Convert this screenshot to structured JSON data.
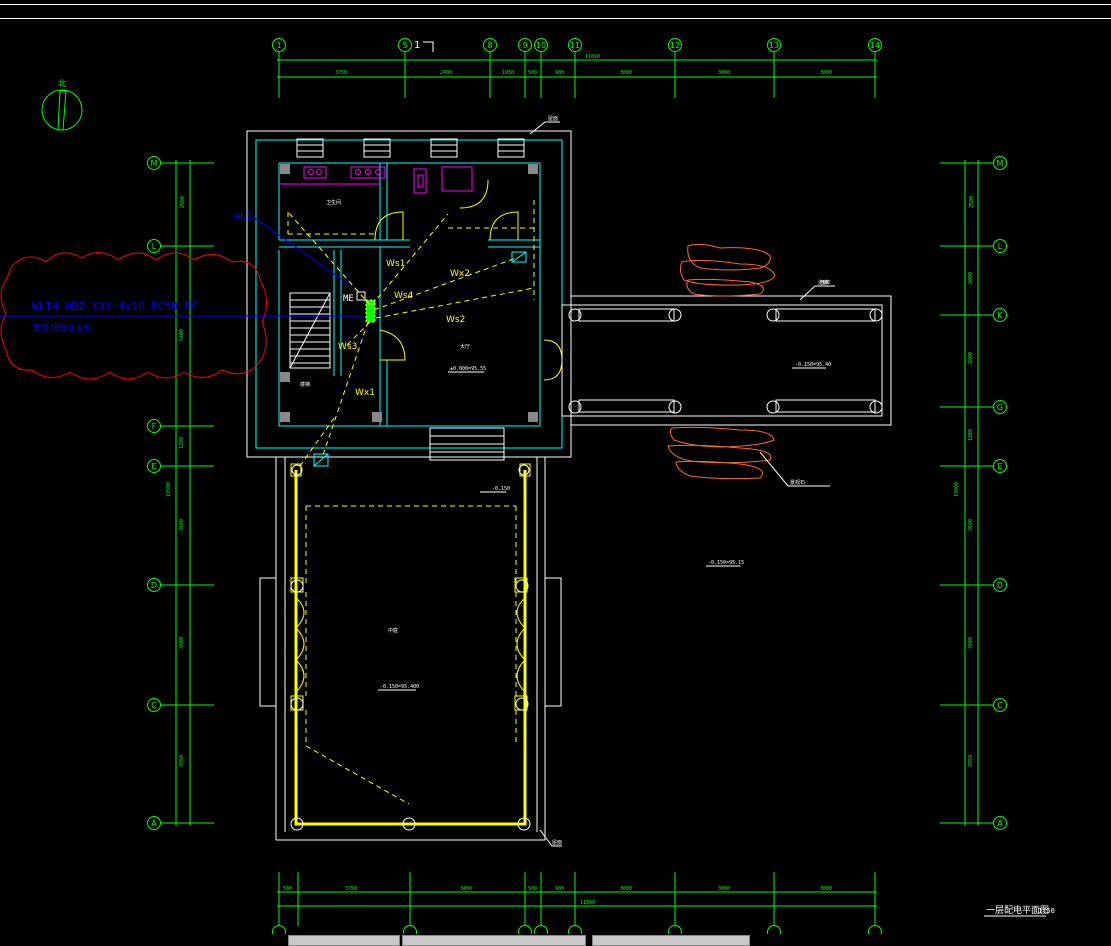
{
  "drawing": {
    "sheet_title": "一层配电平面图",
    "scale": "1:50",
    "north_label": "北",
    "section_mark": "1",
    "cable_label_line1": "WLI4  WDZ-YJY-4x16  PC50  FC",
    "cable_label_line2": "室外埋地0.8米",
    "tag_al": "AL1",
    "tag_mep": "ME",
    "circuit_labels": [
      "Ws1",
      "Wx2",
      "Ws4",
      "Ws2",
      "Ws3",
      "Wx1"
    ],
    "axis_top": [
      "1",
      "5",
      "8",
      "9",
      "10",
      "11",
      "12",
      "13",
      "14"
    ],
    "axis_left": [
      "M",
      "L",
      "F",
      "E",
      "D",
      "C",
      "A"
    ],
    "axis_right": [
      "M",
      "L",
      "K",
      "G",
      "E",
      "D",
      "C",
      "A"
    ],
    "room_labels": {
      "toilet": "卫生间",
      "stair": "楼梯",
      "hall": "大厅",
      "main_hall": "中庭",
      "corridor": "连廊"
    },
    "elevation_labels": {
      "hall": "±0.000=95.55",
      "corridor": "-0.150=95.40",
      "main_hall": "-0.150=95.400",
      "outside": "-0.150=95.15",
      "entry": "-0.150"
    },
    "callout_labels": {
      "top": "屋面",
      "bridge": "连廊",
      "stone": "景观石",
      "bottom": "屋面"
    }
  },
  "colors": {
    "background": "#000000",
    "axis_green": "#00ff00",
    "wall_white": "#ffffff",
    "wall_cyan": "#00ffff",
    "wire_yellow": "#ffff00",
    "cloud_red": "#ff0000",
    "cable_blue": "#0000ff",
    "fixture_magenta": "#ff00ff",
    "stone_orange": "#ff6633"
  },
  "taskbar": {
    "items": [
      "task-item-1",
      "task-item-2",
      "task-item-3"
    ]
  }
}
